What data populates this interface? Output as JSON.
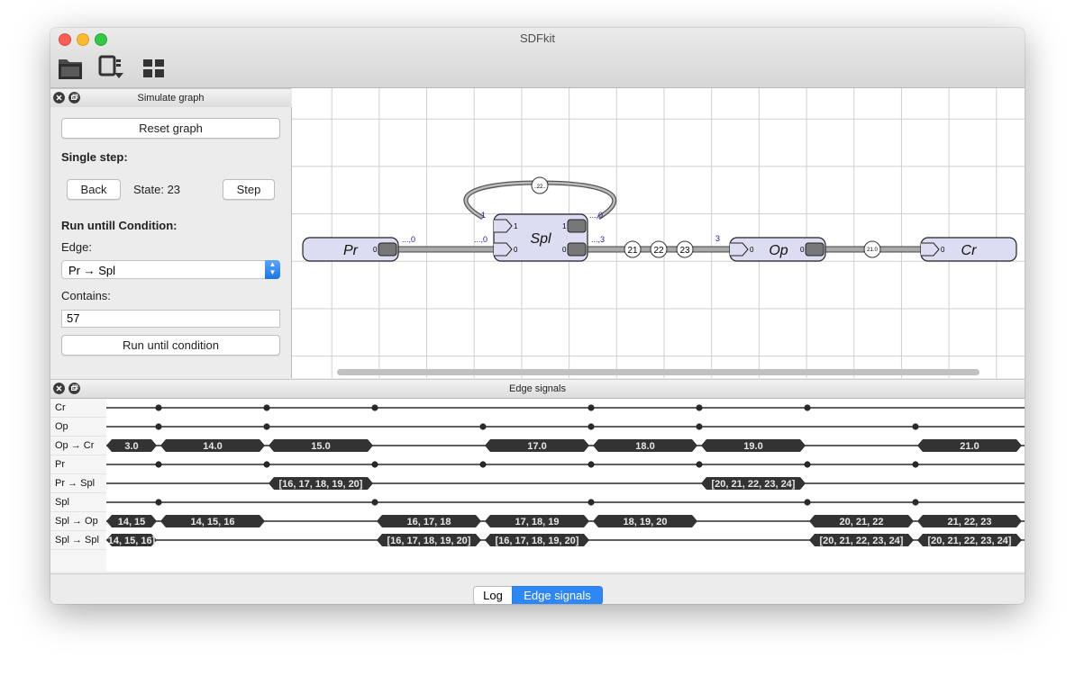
{
  "window": {
    "title": "SDFkit"
  },
  "toolbar": {
    "icons": [
      "open-folder-icon",
      "export-icon",
      "layout-grid-icon"
    ]
  },
  "simulate_panel": {
    "title": "Simulate graph",
    "reset_label": "Reset graph",
    "single_step_label": "Single step:",
    "back_label": "Back",
    "state_text": "State: 23",
    "step_label": "Step",
    "run_until_label": "Run untill Condition:",
    "edge_label": "Edge:",
    "edge_value": "Pr → Spl",
    "contains_label": "Contains:",
    "contains_value": "57",
    "run_button_label": "Run until condition"
  },
  "graph": {
    "nodes": [
      {
        "name": "Pr"
      },
      {
        "name": "Spl"
      },
      {
        "name": "Op"
      },
      {
        "name": "Cr"
      }
    ],
    "port_labels": {
      "pr_out": "0",
      "spl_in0": "0",
      "spl_in1": "1",
      "spl_out0": "0",
      "spl_out1": "1",
      "op_in": "0",
      "op_out": "0",
      "cr_in": "0"
    },
    "edge_labels": {
      "pr_spl_src": "...,0",
      "pr_spl_dst": "...,0",
      "self_src": "...,0",
      "self_dst": "1",
      "spl_op_src": "...,3",
      "spl_op_dst": "3"
    },
    "self_loop_token": "..22..",
    "spl_op_tokens": [
      "21",
      "22",
      "23"
    ],
    "op_cr_token": "21.0"
  },
  "signals_panel": {
    "title": "Edge signals",
    "rows": [
      {
        "label": "Cr",
        "type": "dots",
        "dots": [
          1,
          3,
          5,
          9,
          11,
          13
        ]
      },
      {
        "label": "Op",
        "type": "dots",
        "dots": [
          1,
          3,
          7,
          9,
          11,
          15
        ]
      },
      {
        "label": "Op → Cr",
        "type": "tokens",
        "tokens": [
          {
            "text": "3.0",
            "s": 0,
            "e": 1
          },
          {
            "text": "14.0",
            "s": 1,
            "e": 3
          },
          {
            "text": "15.0",
            "s": 3,
            "e": 5
          },
          {
            "text": "17.0",
            "s": 7,
            "e": 9
          },
          {
            "text": "18.0",
            "s": 9,
            "e": 11
          },
          {
            "text": "19.0",
            "s": 11,
            "e": 13
          },
          {
            "text": "21.0",
            "s": 15,
            "e": 17
          }
        ]
      },
      {
        "label": "Pr",
        "type": "dots",
        "dots": [
          1,
          3,
          5,
          7,
          9,
          11,
          13,
          15
        ]
      },
      {
        "label": "Pr → Spl",
        "type": "tokens",
        "tokens": [
          {
            "text": "[16, 17, 18, 19, 20]",
            "s": 3,
            "e": 5
          },
          {
            "text": "[20, 21, 22, 23, 24]",
            "s": 11,
            "e": 13
          }
        ]
      },
      {
        "label": "Spl",
        "type": "dots",
        "dots": [
          1,
          5,
          9,
          13,
          15
        ]
      },
      {
        "label": "Spl → Op",
        "type": "tokens",
        "tokens": [
          {
            "text": "14, 15",
            "s": 0,
            "e": 1
          },
          {
            "text": "14, 15, 16",
            "s": 1,
            "e": 3
          },
          {
            "text": "16, 17, 18",
            "s": 5,
            "e": 7
          },
          {
            "text": "17, 18, 19",
            "s": 7,
            "e": 9
          },
          {
            "text": "18, 19, 20",
            "s": 9,
            "e": 11
          },
          {
            "text": "20, 21, 22",
            "s": 13,
            "e": 15
          },
          {
            "text": "21, 22, 23",
            "s": 15,
            "e": 17
          }
        ]
      },
      {
        "label": "Spl → Spl",
        "type": "tokens",
        "tokens": [
          {
            "text": "14, 15, 16]",
            "s": 0,
            "e": 1
          },
          {
            "text": "[16, 17, 18, 19, 20]",
            "s": 5,
            "e": 7
          },
          {
            "text": "[16, 17, 18, 19, 20]",
            "s": 7,
            "e": 9
          },
          {
            "text": "[20, 21, 22, 23, 24]",
            "s": 13,
            "e": 15
          },
          {
            "text": "[20, 21, 22, 23, 24]",
            "s": 15,
            "e": 17
          }
        ]
      }
    ]
  },
  "bottom_tabs": {
    "log": "Log",
    "edge_signals": "Edge signals"
  },
  "colors": {
    "accent": "#1a7cf0",
    "node_fill": "#dcdcf2",
    "token_fill": "#333333"
  }
}
